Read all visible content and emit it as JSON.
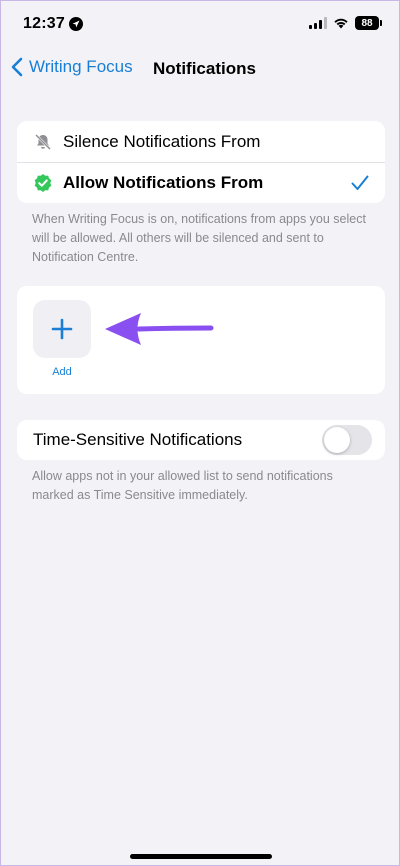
{
  "status_bar": {
    "time": "12:37",
    "battery": "88"
  },
  "nav": {
    "back_label": "Writing Focus",
    "title": "Notifications"
  },
  "mode_options": {
    "silence_label": "Silence Notifications From",
    "allow_label": "Allow Notifications From",
    "selected": "allow",
    "description": "When Writing Focus is on, notifications from apps you select will be allowed. All others will be silenced and sent to Notification Centre."
  },
  "apps": {
    "add_label": "Add"
  },
  "time_sensitive": {
    "label": "Time-Sensitive Notifications",
    "enabled": false,
    "description": "Allow apps not in your allowed list to send notifications marked as Time Sensitive immediately."
  },
  "colors": {
    "accent": "#1a7fd4",
    "allow_badge": "#34c759",
    "annotation_arrow": "#8a4ff0",
    "background": "#f2f2f7"
  },
  "icons": {
    "location": "location-arrow-icon",
    "silence": "bell-slash-icon",
    "allow": "check-badge-icon",
    "selected": "checkmark-icon",
    "add": "plus-icon",
    "annotation": "arrow-left-icon"
  }
}
